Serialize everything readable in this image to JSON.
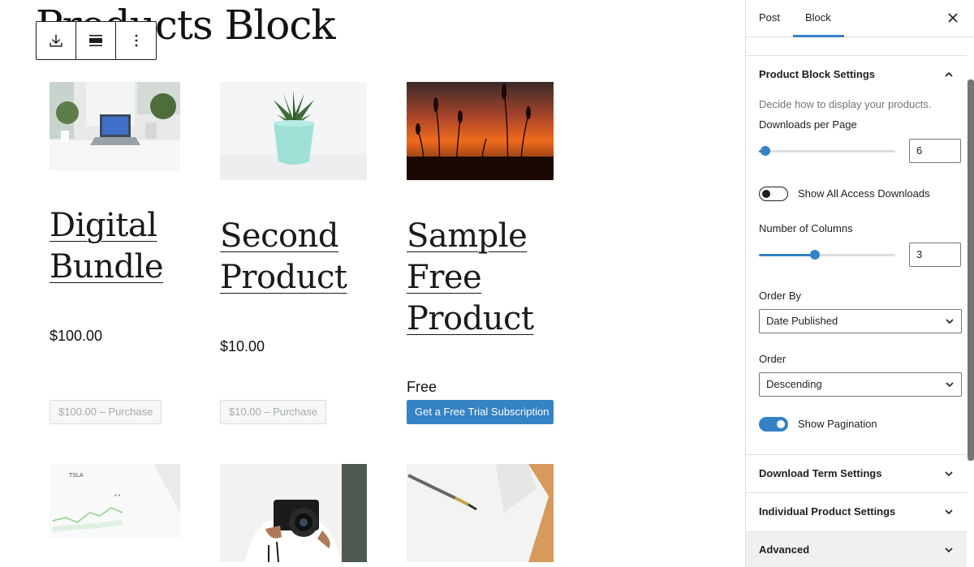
{
  "canvas": {
    "page_title": "Products Block",
    "toolbar": {
      "icons": [
        "download-icon",
        "align-icon",
        "more-options-icon"
      ]
    },
    "products": [
      {
        "title_lines": [
          "Digital",
          "Bundle"
        ],
        "price": "$100.00",
        "button": "$100.00 – Purchase",
        "button_style": "disabled"
      },
      {
        "title_lines": [
          "Second",
          "Product"
        ],
        "price": "$10.00",
        "button": "$10.00 – Purchase",
        "button_style": "disabled"
      },
      {
        "title_lines": [
          "Sample",
          "Free",
          "Product"
        ],
        "price": "Free",
        "button": "Get a Free Trial Subscription",
        "button_style": "primary"
      }
    ],
    "second_row_images": [
      "tablet-chart-photo",
      "camera-photo",
      "pen-paper-photo"
    ]
  },
  "sidebar": {
    "tabs": [
      {
        "label": "Post",
        "active": false
      },
      {
        "label": "Block",
        "active": true
      }
    ],
    "close_icon": "close-icon",
    "product_block_settings": {
      "title": "Product Block Settings",
      "expanded": true,
      "help": "Decide how to display your products.",
      "downloads_per_page": {
        "label": "Downloads per Page",
        "value": "6",
        "slider_fraction": 0.05
      },
      "show_all_access": {
        "label": "Show All Access Downloads",
        "checked": false
      },
      "number_of_columns": {
        "label": "Number of Columns",
        "value": "3",
        "slider_fraction": 0.41
      },
      "order_by": {
        "label": "Order By",
        "value": "Date Published"
      },
      "order": {
        "label": "Order",
        "value": "Descending"
      },
      "show_pagination": {
        "label": "Show Pagination",
        "checked": true
      }
    },
    "collapsed_panels": [
      {
        "title": "Download Term Settings"
      },
      {
        "title": "Individual Product Settings"
      },
      {
        "title": "Advanced"
      }
    ]
  },
  "colors": {
    "accent": "#3582c4",
    "text": "#1e1e1e",
    "muted": "#757575",
    "disabled_button_bg": "#f6f7f7",
    "disabled_button_text": "#a7aaad"
  }
}
